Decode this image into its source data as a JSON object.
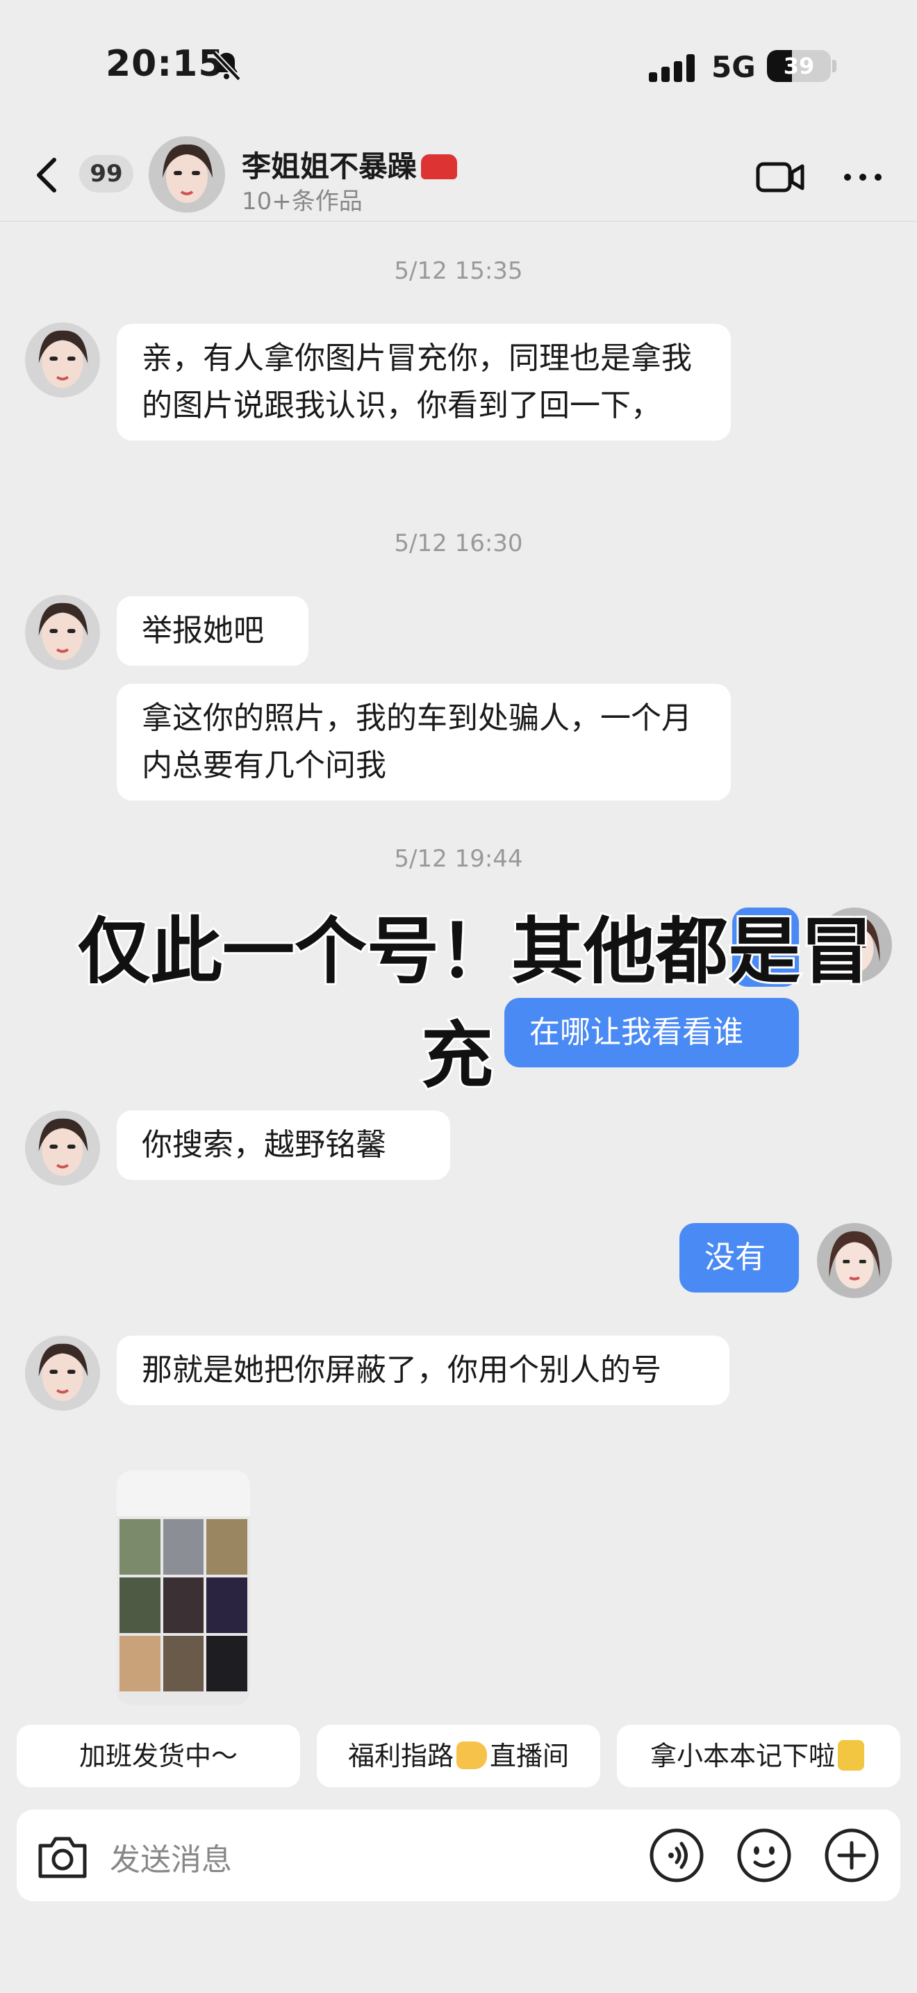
{
  "status_bar": {
    "time": "20:15",
    "network": "5G",
    "battery_percent": "39",
    "battery_level": 0.39,
    "mute_icon": "bell-slash-icon",
    "signal_icon": "signal-bars-icon"
  },
  "header": {
    "back_icon": "chevron-left-icon",
    "unread_badge": "99",
    "contact_name": "李姐姐不暴躁",
    "contact_emoji": "car-emoji",
    "contact_subtitle": "10+条作品",
    "video_icon": "video-camera-icon",
    "more_icon": "ellipsis-icon"
  },
  "messages": {
    "ts1": "5/12 15:35",
    "m1": "亲，有人拿你图片冒充你，同理也是拿我的图片说跟我认识，你看到了回一下，",
    "ts2": "5/12 16:30",
    "m2": "举报她吧",
    "m3": "拿这你的照片，我的车到处骗人，一个月内总要有几个问我",
    "ts3": "5/12 19:44",
    "m5": "在哪让我看看谁",
    "m6": "你搜索，越野铭馨",
    "m7": "没有",
    "m8": "那就是她把你屏蔽了，你用个别人的号",
    "image_message": "screenshot-thumbnail"
  },
  "overlay": {
    "line1": "仅此一个号！其他都是冒",
    "line2": "充"
  },
  "quick_replies": [
    {
      "label": "加班发货中～"
    },
    {
      "label_before": "福利指路",
      "emoji": "pointing-hand-emoji",
      "label_after": "直播间"
    },
    {
      "label": "拿小本本记下啦",
      "emoji": "notebook-emoji"
    }
  ],
  "input": {
    "placeholder": "发送消息",
    "camera_icon": "camera-icon",
    "voice_icon": "voice-wave-icon",
    "emoji_icon": "smiley-face-icon",
    "plus_icon": "plus-circle-icon"
  },
  "colors": {
    "background": "#ededed",
    "my_bubble": "#4a8af4",
    "their_bubble": "#ffffff",
    "timestamp": "#999999"
  }
}
